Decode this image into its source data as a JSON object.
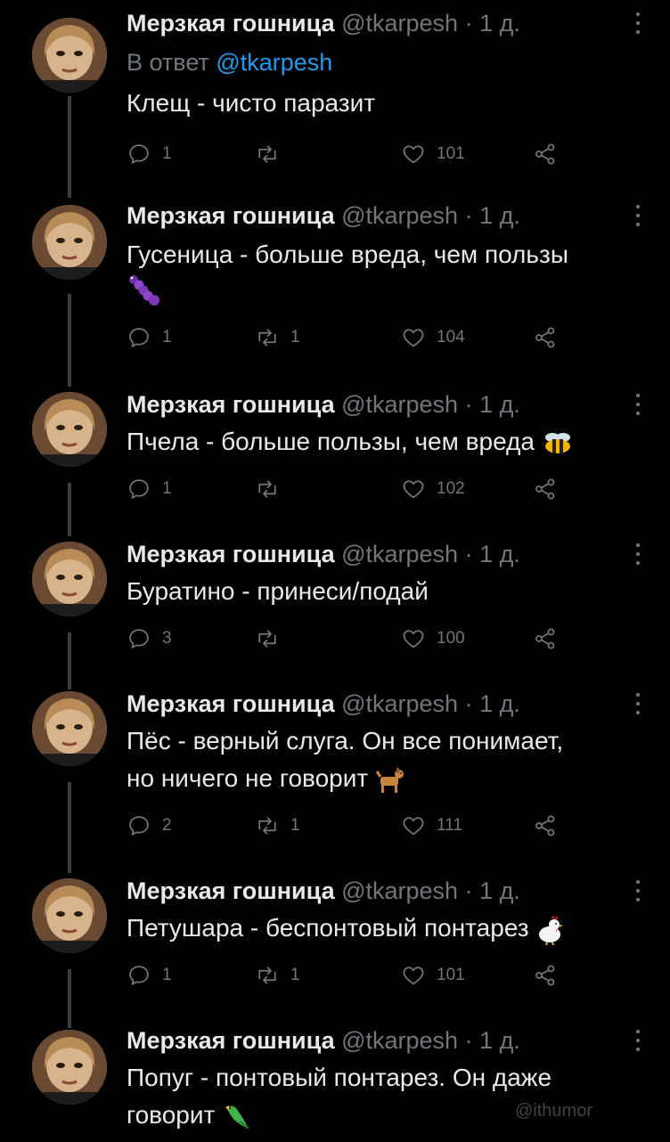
{
  "tweets": [
    {
      "name": "Мерзкая гошница",
      "handle": "@tkarpesh",
      "time": "1 д.",
      "reply_prefix": "В ответ",
      "reply_link": "@tkarpesh",
      "text": "Клещ - чисто паразит",
      "replies": "1",
      "retweets": "",
      "likes": "101"
    },
    {
      "name": "Мерзкая гошница",
      "handle": "@tkarpesh",
      "time": "1 д.",
      "text": "Гусеница - больше вреда, чем пользы",
      "replies": "1",
      "retweets": "1",
      "likes": "104",
      "emoji": "caterpillar-emoji"
    },
    {
      "name": "Мерзкая гошница",
      "handle": "@tkarpesh",
      "time": "1 д.",
      "text": "Пчела - больше пользы, чем вреда",
      "replies": "1",
      "retweets": "",
      "likes": "102",
      "emoji": "bee-emoji"
    },
    {
      "name": "Мерзкая гошница",
      "handle": "@tkarpesh",
      "time": "1 д.",
      "text": "Буратино - принеси/подай",
      "replies": "3",
      "retweets": "",
      "likes": "100"
    },
    {
      "name": "Мерзкая гошница",
      "handle": "@tkarpesh",
      "time": "1 д.",
      "text_line1": "Пёс - верный слуга. Он все понимает,",
      "text_line2": "но ничего не говорит",
      "replies": "2",
      "retweets": "1",
      "likes": "111",
      "emoji": "dog-emoji"
    },
    {
      "name": "Мерзкая гошница",
      "handle": "@tkarpesh",
      "time": "1 д.",
      "text": "Петушара - беспонтовый понтарез",
      "replies": "1",
      "retweets": "1",
      "likes": "101",
      "emoji": "rooster-emoji"
    },
    {
      "name": "Мерзкая гошница",
      "handle": "@tkarpesh",
      "time": "1 д.",
      "text_line1": "Попуг - понтовый понтарез. Он даже",
      "text_line2": "говорит",
      "emoji": "parrot-emoji"
    }
  ],
  "separator": "·",
  "watermark": "@ithumor",
  "colors": {
    "background": "#000000",
    "text": "#e7e9ea",
    "muted": "#71767b",
    "link": "#1d9bf0",
    "thread_line": "#3a3d40"
  }
}
